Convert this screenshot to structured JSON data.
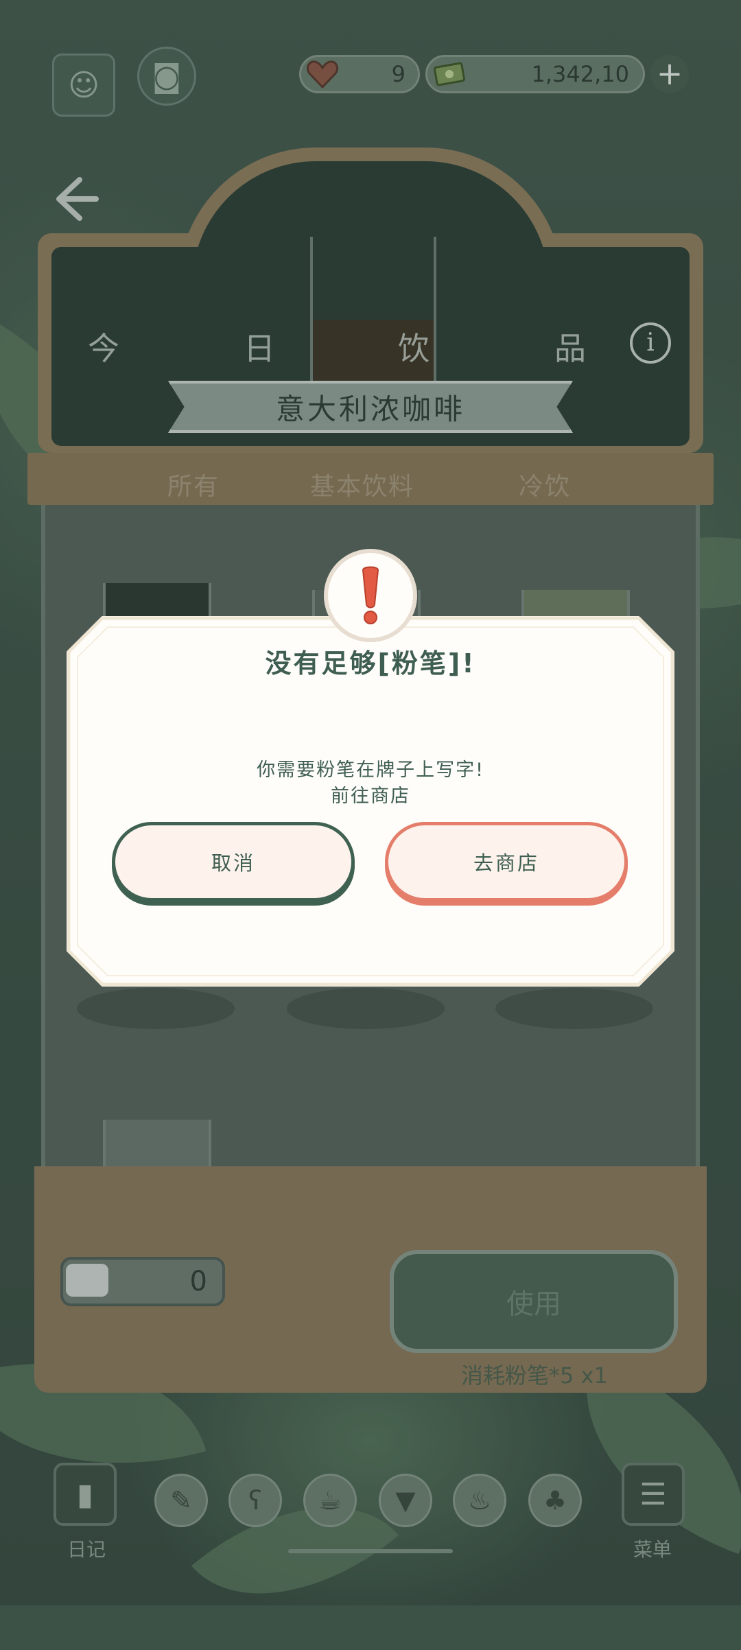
{
  "hud": {
    "hearts": "9",
    "currency": "1,342,10",
    "add_label": "+"
  },
  "board": {
    "chars": [
      "今",
      "日",
      "饮",
      "品"
    ],
    "drink_name": "意大利浓咖啡",
    "info_label": "i"
  },
  "tabs": [
    "所有",
    "基本饮料",
    "冷饮"
  ],
  "counter": {
    "chalk_count": "0",
    "use_label": "使用",
    "cost_text": "消耗粉笔*5 x1"
  },
  "nav": {
    "diary_label": "日记",
    "menu_label": "菜单",
    "icons": [
      "tag-icon",
      "bear-icon",
      "cup-icon",
      "mug-icon",
      "kettle-icon",
      "plant-icon"
    ]
  },
  "dialog": {
    "title": "没有足够[粉笔]!",
    "message_line1": "你需要粉笔在牌子上写字!",
    "message_line2": "前往商店",
    "cancel_label": "取消",
    "shop_label": "去商店"
  },
  "colors": {
    "dialog_bg": "#fffdf9",
    "text_green": "#3f5e52",
    "cancel_border": "#3f6152",
    "shop_border": "#e47e6b",
    "alert_red": "#e25a43"
  }
}
